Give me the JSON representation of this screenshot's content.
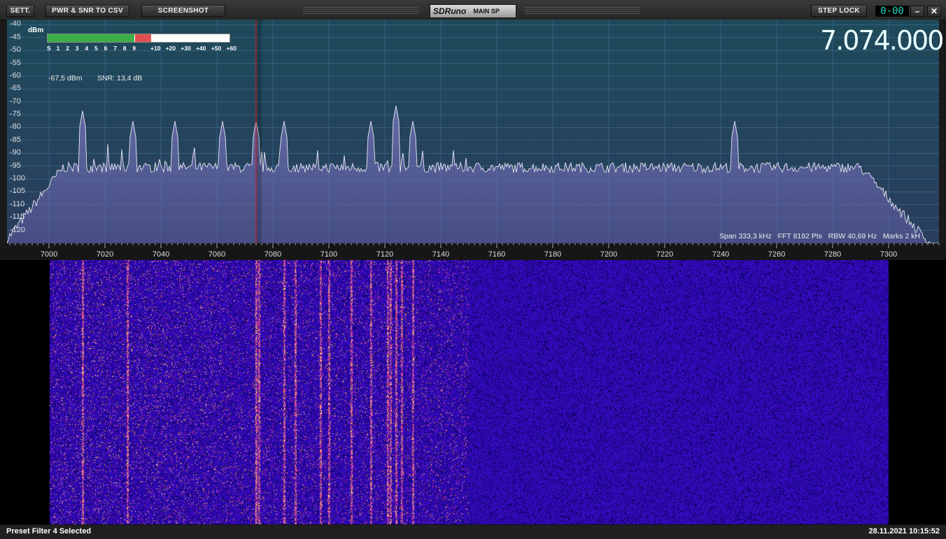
{
  "toolbar": {
    "settings_label": "SETT.",
    "csv_label": "PWR & SNR TO CSV",
    "screenshot_label": "SCREENSHOT",
    "brand": "SDRuno",
    "window_name": "MAIN SP",
    "step_lock_label": "STEP LOCK",
    "lcd_value": "0-00",
    "minimize_label": "–",
    "close_label": "✕"
  },
  "meter": {
    "unit_label": "dBm",
    "scale": [
      "S",
      "1",
      "2",
      "3",
      "4",
      "5",
      "6",
      "7",
      "8",
      "9",
      "+10",
      "+20",
      "+30",
      "+40",
      "+50",
      "+60"
    ],
    "power_readout": "-67,5 dBm",
    "snr_readout": "SNR: 13,4 dB",
    "level_fraction": 0.57
  },
  "frequency_display": "7.074.000",
  "spectrum_info": {
    "span": "Span 333,3 kHz",
    "fft": "FFT 8192 Pts",
    "rbw": "RBW 40,69 Hz",
    "marks": "Marks 2 kH"
  },
  "y_axis": {
    "labels": [
      "-40",
      "-45",
      "-50",
      "-55",
      "-60",
      "-65",
      "-70",
      "-75",
      "-80",
      "-85",
      "-90",
      "-95",
      "-100",
      "-105",
      "-110",
      "-115",
      "-120"
    ],
    "min": -125,
    "max": -38
  },
  "x_axis": {
    "labels": [
      "7000",
      "7020",
      "7040",
      "7060",
      "7080",
      "7100",
      "7120",
      "7140",
      "7160",
      "7180",
      "7200",
      "7220",
      "7240",
      "7260",
      "7280",
      "7300"
    ],
    "min": 6985,
    "max": 7318
  },
  "tuned_frequency_khz": 7074,
  "peaks_khz": [
    7012,
    7074,
    7084,
    7115,
    7124,
    7130,
    7245,
    7030,
    7045,
    7062
  ],
  "status": {
    "left": "Preset Filter 4 Selected",
    "right": "28.11.2021 10:15:52"
  },
  "colors": {
    "accent": "#1fd6c2",
    "marker": "#cc2020",
    "meter_green": "#3eae4a",
    "meter_red": "#e05050"
  }
}
